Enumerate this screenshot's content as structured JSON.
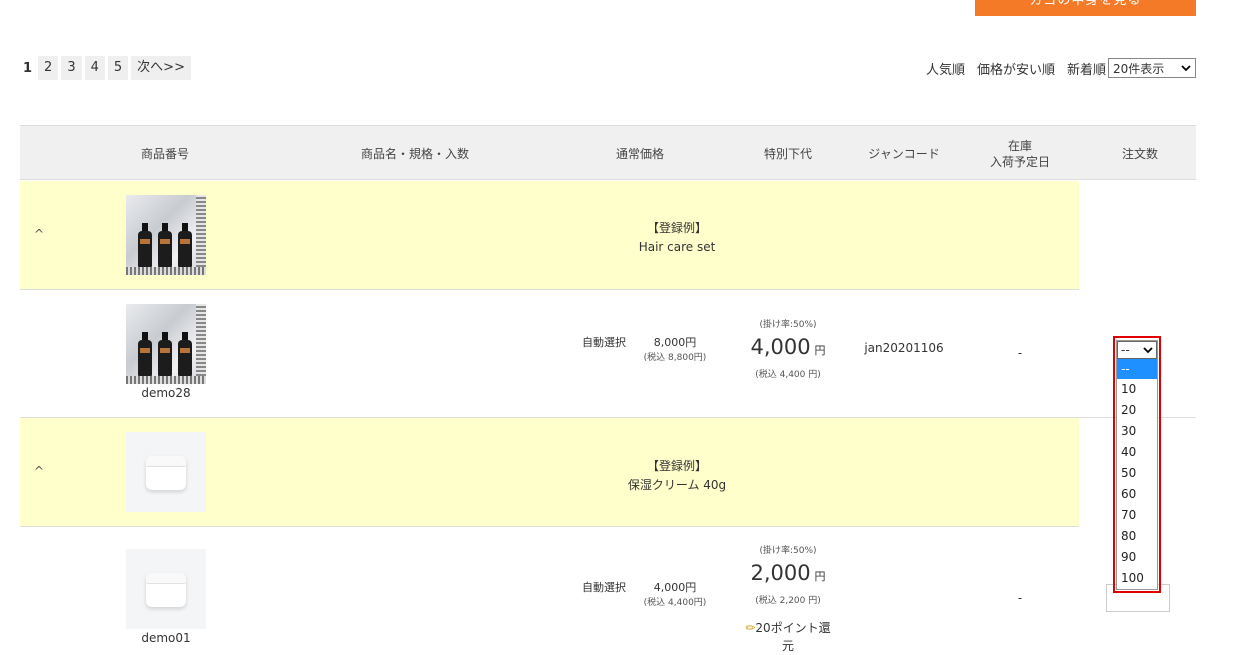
{
  "header": {
    "cart_button": "カゴの中身を見る"
  },
  "pager": {
    "current": "1",
    "pages": [
      "2",
      "3",
      "4",
      "5"
    ],
    "next": "次へ>>"
  },
  "sort": {
    "popular": "人気順",
    "cheap": "価格が安い順",
    "newest": "新着順",
    "per_page": "20件表示"
  },
  "table": {
    "headers": {
      "code": "商品番号",
      "name": "商品名・規格・入数",
      "price": "通常価格",
      "wholesale": "特別下代",
      "jan": "ジャンコード",
      "stock_line1": "在庫",
      "stock_line2": "入荷予定日",
      "qty": "注文数"
    }
  },
  "products": [
    {
      "badge": "【登録例】",
      "title": "Hair care set",
      "caret": "^",
      "code": "demo28",
      "variant": "自動選択",
      "price": "8,000円",
      "price_tax": "(税込 8,800円)",
      "rate": "(掛け率:50%)",
      "wholesale": "4,000",
      "yen": "円",
      "wholesale_tax": "(税込 4,400 円)",
      "jan": "jan20201106",
      "stock": "-"
    },
    {
      "badge": "【登録例】",
      "title": "保湿クリーム 40g",
      "caret": "^",
      "code": "demo01",
      "variant": "自動選択",
      "price": "4,000円",
      "price_tax": "(税込 4,400円)",
      "rate": "(掛け率:50%)",
      "wholesale": "2,000",
      "yen": "円",
      "wholesale_tax": "(税込 2,200 円)",
      "points": "20ポイント還",
      "points_cont": "元",
      "stock": "-"
    }
  ],
  "qty_dropdown": {
    "selected": "--",
    "options": [
      "--",
      "10",
      "20",
      "30",
      "40",
      "50",
      "60",
      "70",
      "80",
      "90",
      "100"
    ]
  }
}
